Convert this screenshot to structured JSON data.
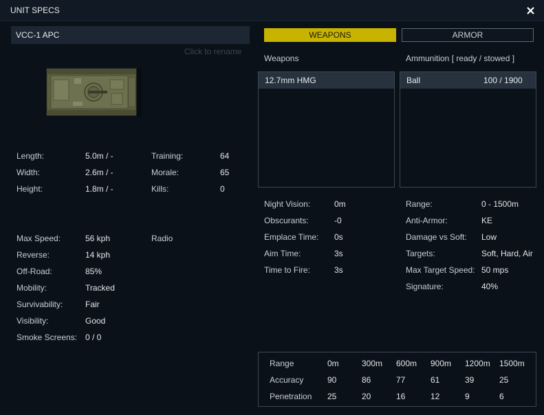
{
  "window": {
    "title": "UNIT SPECS"
  },
  "unit": {
    "name": "VCC-1 APC",
    "rename_hint": "Click to rename"
  },
  "dims": {
    "length_label": "Length:",
    "length": "5.0m / -",
    "width_label": "Width:",
    "width": "2.6m / -",
    "height_label": "Height:",
    "height": "1.8m / -"
  },
  "crew": {
    "training_label": "Training:",
    "training": "64",
    "morale_label": "Morale:",
    "morale": "65",
    "kills_label": "Kills:",
    "kills": "0"
  },
  "mobility": {
    "max_speed_label": "Max Speed:",
    "max_speed": "56 kph",
    "reverse_label": "Reverse:",
    "reverse": "14 kph",
    "offroad_label": "Off-Road:",
    "offroad": "85%",
    "mobility_label": "Mobility:",
    "mobility": "Tracked",
    "survivability_label": "Survivability:",
    "survivability": "Fair",
    "visibility_label": "Visibility:",
    "visibility": "Good",
    "smoke_label": "Smoke Screens:",
    "smoke": "0 / 0",
    "radio": "Radio"
  },
  "tabs": {
    "weapons": "WEAPONS",
    "armor": "ARMOR"
  },
  "weapons": {
    "header": "Weapons",
    "items": [
      {
        "name": "12.7mm HMG"
      }
    ],
    "ammo_header": "Ammunition [ ready / stowed ]",
    "ammo": [
      {
        "name": "Ball",
        "count": "100 / 1900"
      }
    ]
  },
  "stats_left": {
    "night_vision_label": "Night Vision:",
    "night_vision": "0m",
    "obscurants_label": "Obscurants:",
    "obscurants": "-0",
    "emplace_label": "Emplace Time:",
    "emplace": "0s",
    "aim_label": "Aim Time:",
    "aim": "3s",
    "fire_label": "Time to Fire:",
    "fire": "3s"
  },
  "stats_right": {
    "range_label": "Range:",
    "range": "0 - 1500m",
    "anti_armor_label": "Anti-Armor:",
    "anti_armor": "KE",
    "dmg_soft_label": "Damage vs Soft:",
    "dmg_soft": "Low",
    "targets_label": "Targets:",
    "targets": "Soft, Hard, Air",
    "max_target_speed_label": "Max Target Speed:",
    "max_target_speed": "50 mps",
    "signature_label": "Signature:",
    "signature": "40%"
  },
  "range_table": {
    "header": [
      "Range",
      "0m",
      "300m",
      "600m",
      "900m",
      "1200m",
      "1500m"
    ],
    "accuracy": [
      "Accuracy",
      "90",
      "86",
      "77",
      "61",
      "39",
      "25"
    ],
    "penetration": [
      "Penetration",
      "25",
      "20",
      "16",
      "12",
      "9",
      "6"
    ]
  },
  "colors": {
    "background": "#0a1119",
    "titlebar": "#111a24",
    "accent_tab": "#c8b400",
    "selected_row": "#27323e",
    "border": "#3c4753"
  },
  "icons": {
    "close": "close-icon",
    "vehicle": "vehicle-image"
  }
}
